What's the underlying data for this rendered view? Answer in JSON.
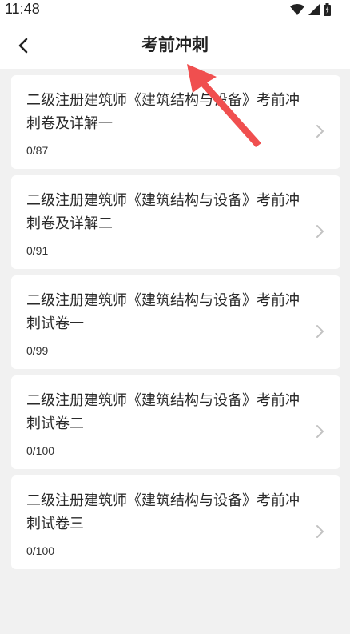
{
  "status_bar": {
    "time": "11:48",
    "icons": [
      "wifi-icon",
      "cellular-signal-icon",
      "battery-icon"
    ]
  },
  "header": {
    "back_icon": "chevron-left-icon",
    "title": "考前冲刺"
  },
  "items": [
    {
      "title": "二级注册建筑师《建筑结构与设备》考前冲刺卷及详解一",
      "progress": "0/87"
    },
    {
      "title": "二级注册建筑师《建筑结构与设备》考前冲刺卷及详解二",
      "progress": "0/91"
    },
    {
      "title": "二级注册建筑师《建筑结构与设备》考前冲刺试卷一",
      "progress": "0/99"
    },
    {
      "title": "二级注册建筑师《建筑结构与设备》考前冲刺试卷二",
      "progress": "0/100"
    },
    {
      "title": "二级注册建筑师《建筑结构与设备》考前冲刺试卷三",
      "progress": "0/100"
    }
  ],
  "colors": {
    "background": "#f1f1f1",
    "card": "#ffffff",
    "annotation_arrow": "#f04f4f"
  }
}
